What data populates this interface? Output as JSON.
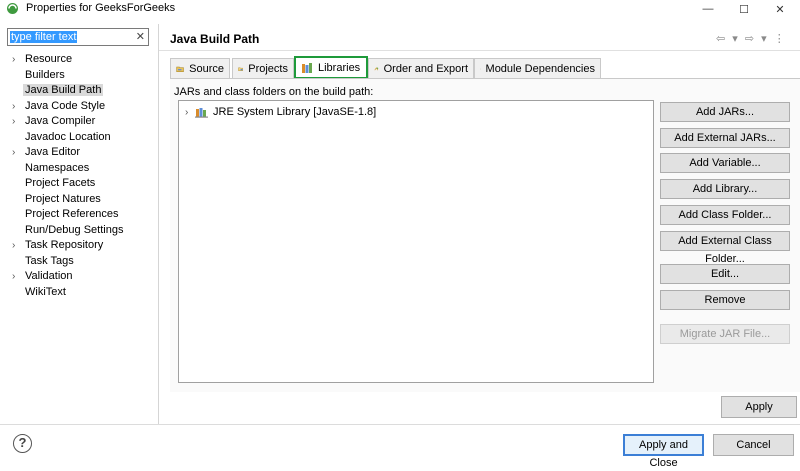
{
  "window": {
    "title": "Properties for GeeksForGeeks",
    "minimize": "—",
    "maximize": "☐",
    "close": "✕"
  },
  "filter": {
    "value": "type filter text",
    "clear_icon": "✕"
  },
  "tree": [
    {
      "label": "Resource",
      "expandable": true
    },
    {
      "label": "Builders",
      "expandable": false
    },
    {
      "label": "Java Build Path",
      "expandable": false,
      "selected": true
    },
    {
      "label": "Java Code Style",
      "expandable": true
    },
    {
      "label": "Java Compiler",
      "expandable": true
    },
    {
      "label": "Javadoc Location",
      "expandable": false
    },
    {
      "label": "Java Editor",
      "expandable": true
    },
    {
      "label": "Namespaces",
      "expandable": false
    },
    {
      "label": "Project Facets",
      "expandable": false
    },
    {
      "label": "Project Natures",
      "expandable": false
    },
    {
      "label": "Project References",
      "expandable": false
    },
    {
      "label": "Run/Debug Settings",
      "expandable": false
    },
    {
      "label": "Task Repository",
      "expandable": true
    },
    {
      "label": "Task Tags",
      "expandable": false
    },
    {
      "label": "Validation",
      "expandable": true
    },
    {
      "label": "WikiText",
      "expandable": false
    }
  ],
  "page": {
    "title": "Java Build Path",
    "nav": "⇦ ▾ ⇨ ▾ ⋮"
  },
  "tabs": [
    {
      "label": "Source",
      "icon": "source-folder-icon"
    },
    {
      "label": "Projects",
      "icon": "projects-icon"
    },
    {
      "label": "Libraries",
      "icon": "libraries-icon",
      "active": true
    },
    {
      "label": "Order and Export",
      "icon": "order-export-icon"
    },
    {
      "label": "Module Dependencies",
      "icon": "module-icon"
    }
  ],
  "libraries": {
    "caption": "JARs and class folders on the build path:",
    "items": [
      {
        "label": "JRE System Library [JavaSE-1.8]"
      }
    ]
  },
  "buttons": {
    "add_jars": "Add JARs...",
    "add_external_jars": "Add External JARs...",
    "add_variable": "Add Variable...",
    "add_library": "Add Library...",
    "add_class_folder": "Add Class Folder...",
    "add_external_class_folder": "Add External Class Folder...",
    "edit": "Edit...",
    "remove": "Remove",
    "migrate_jar": "Migrate JAR File...",
    "apply": "Apply",
    "apply_and_close": "Apply and Close",
    "cancel": "Cancel"
  },
  "help": "?",
  "colors": {
    "highlight_border": "#1e9a3a",
    "selection": "#3399ff",
    "default_button_border": "#3c7fd6"
  }
}
